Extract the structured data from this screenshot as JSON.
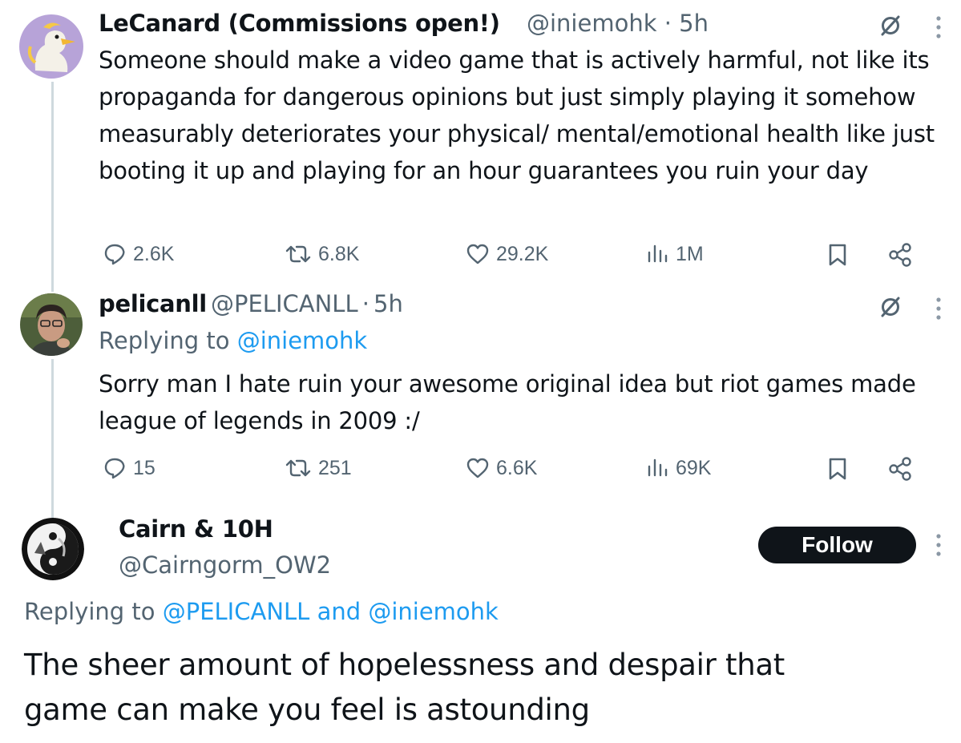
{
  "tweets": [
    {
      "author_name": "LeCanard (Commissions open!)",
      "handle": "@iniemohk",
      "separator": "·",
      "time": "5h",
      "text": "Someone should make a video game that is actively harmful, not like its propaganda for dangerous opinions but just simply playing it somehow measurably deteriorates your physical/ mental/emotional health like just booting it up and playing for an hour guarantees you ruin your day",
      "replies": "2.6K",
      "reposts": "6.8K",
      "likes": "29.2K",
      "views": "1M"
    },
    {
      "author_name": "pelicanll",
      "handle": "@PELICANLL",
      "separator": "·",
      "time": "5h",
      "replying_prefix": "Replying to",
      "replying_to": "@iniemohk",
      "text": "Sorry man I hate ruin your awesome original idea but riot games made league of legends in 2009 :/",
      "replies": "15",
      "reposts": "251",
      "likes": "6.6K",
      "views": "69K"
    }
  ],
  "main_tweet": {
    "author_name": "Cairn & 10H",
    "handle": "@Cairngorm_OW2",
    "follow_label": "Follow",
    "replying_prefix": "Replying to",
    "replying_to_1": "@PELICANLL",
    "replying_and": "and",
    "replying_to_2": "@iniemohk",
    "text": "The sheer amount of hopelessness and despair that game can make you feel is astounding"
  },
  "icons": {
    "more": "more-vertical-icon",
    "grok": "grok-icon",
    "reply": "reply-icon",
    "repost": "repost-icon",
    "like": "heart-icon",
    "views": "views-icon",
    "bookmark": "bookmark-icon",
    "share": "share-icon"
  },
  "colors": {
    "text": "#0f1419",
    "secondary": "#536471",
    "link": "#1d9bf0",
    "thread_line": "#cfd9de",
    "follow_bg": "#0f1419"
  }
}
